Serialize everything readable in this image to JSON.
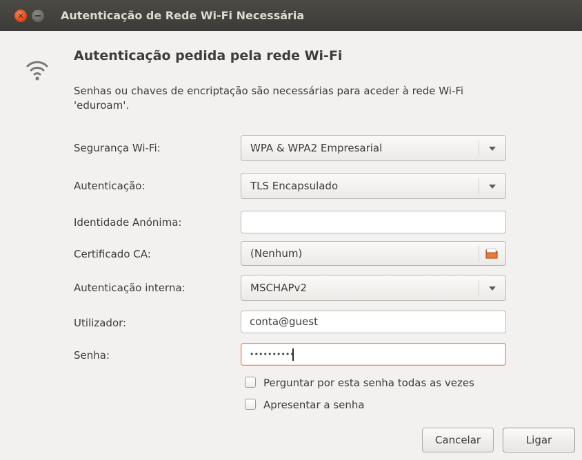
{
  "window": {
    "title": "Autenticação de Rede Wi-Fi Necessária"
  },
  "header": {
    "icon": "wifi-icon",
    "heading": "Autenticação pedida pela rede Wi-Fi",
    "description_line1": "Senhas ou chaves de encriptação são necessárias para aceder à rede Wi-Fi",
    "description_line2": "'eduroam'."
  },
  "form": {
    "security": {
      "label": "Segurança Wi-Fi:",
      "value": "WPA & WPA2 Empresarial"
    },
    "authentication": {
      "label": "Autenticação:",
      "value": "TLS Encapsulado"
    },
    "anonymous_identity": {
      "label": "Identidade Anónima:",
      "value": ""
    },
    "ca_certificate": {
      "label": "Certificado CA:",
      "value": "(Nenhum)"
    },
    "inner_authentication": {
      "label": "Autenticação interna:",
      "value": "MSCHAPv2"
    },
    "username": {
      "label": "Utilizador:",
      "value": "conta@guest"
    },
    "password": {
      "label": "Senha:",
      "masked_value": "••••••••••"
    },
    "ask_password_checkbox": {
      "label": "Perguntar por esta senha todas as vezes",
      "checked": false
    },
    "show_password_checkbox": {
      "label": "Apresentar a senha",
      "checked": false
    }
  },
  "buttons": {
    "cancel": "Cancelar",
    "connect": "Ligar"
  },
  "colors": {
    "titlebar": "#3c3b37",
    "close_button": "#df4a16",
    "focus_border": "#e9835b",
    "background": "#f2f1f0"
  }
}
